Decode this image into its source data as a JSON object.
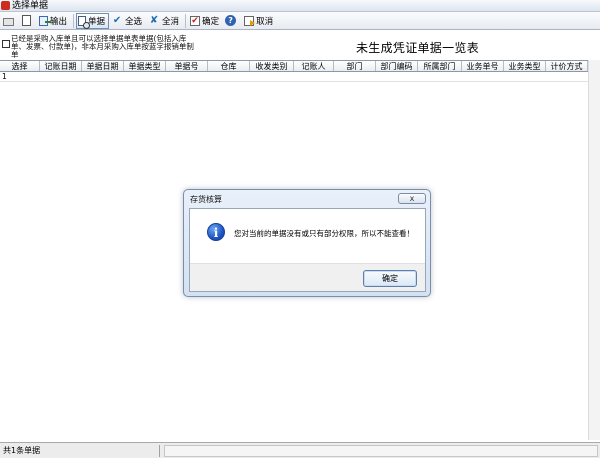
{
  "window": {
    "title": "选择单据"
  },
  "toolbar": {
    "export_label": "输出",
    "document_label": "单据",
    "select_all_label": "全选",
    "clear_all_label": "全消",
    "confirm_label": "确定",
    "cancel_label": "取消"
  },
  "filter": {
    "checked": false,
    "text": "已经是采购入库单且可以选择单据单表单据(包括入库单、发票、付款单)，非本月采购入库单按蓝字报销单制单"
  },
  "sheet_title": "未生成凭证单据一览表",
  "grid": {
    "columns": [
      "选择",
      "记账日期",
      "单据日期",
      "单据类型",
      "单据号",
      "仓库",
      "收发类别",
      "记账人",
      "部门",
      "部门编码",
      "所属部门",
      "业务单号",
      "业务类型",
      "计价方式"
    ],
    "rows": [
      [
        "1",
        "",
        "",
        "",
        "",
        "",
        "",
        "",
        "",
        "",
        "",
        "",
        "",
        ""
      ]
    ]
  },
  "status": {
    "count_text": "共1条单据"
  },
  "dialog": {
    "title": "存货核算",
    "close_glyph": "x",
    "message": "您对当前的单据没有或只有部分权限，所以不能查看！",
    "ok_label": "确定",
    "info_glyph": "i"
  }
}
